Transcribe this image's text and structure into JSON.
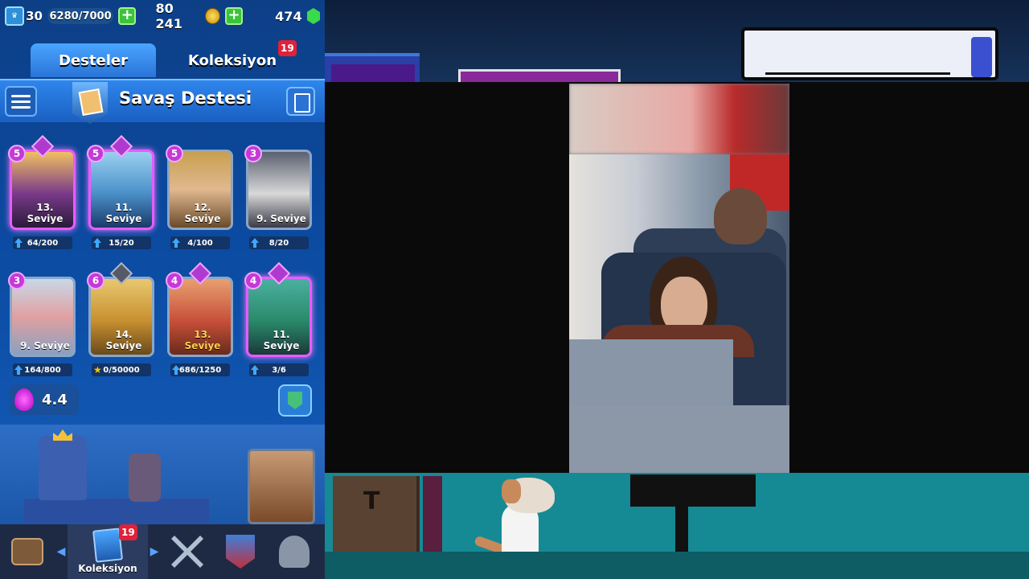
{
  "game": {
    "topbar": {
      "king_level": "30",
      "xp": "6280/7000",
      "gold": "80 241",
      "gems": "474"
    },
    "tabs": {
      "decks_label": "Desteler",
      "collection_label": "Koleksiyon",
      "collection_badge": "19"
    },
    "deck": {
      "title": "Savaş Destesi"
    },
    "cards": [
      {
        "elixir": "5",
        "level": "13. Seviye",
        "progress": "64/200",
        "rarity": "legendary"
      },
      {
        "elixir": "5",
        "level": "11. Seviye",
        "progress": "15/20",
        "rarity": "legendary"
      },
      {
        "elixir": "5",
        "level": "12. Seviye",
        "progress": "4/100",
        "rarity": "rare"
      },
      {
        "elixir": "3",
        "level": "9. Seviye",
        "progress": "8/20",
        "rarity": "epic"
      },
      {
        "elixir": "3",
        "level": "9. Seviye",
        "progress": "164/800",
        "rarity": "rare"
      },
      {
        "elixir": "6",
        "level": "14. Seviye",
        "progress": "0/50000",
        "rarity": "champion"
      },
      {
        "elixir": "4",
        "level": "13. Seviye",
        "progress": "686/1250",
        "rarity": "epic"
      },
      {
        "elixir": "4",
        "level": "11. Seviye",
        "progress": "3/6",
        "rarity": "legendary"
      }
    ],
    "average_elixir": "4.4",
    "bottom_nav": {
      "collection_label": "Koleksiyon",
      "collection_badge": "19"
    }
  },
  "overlay": {
    "speech_bubble_text": ""
  },
  "colors": {
    "game_bg": "#0b4aa0",
    "accent_blue": "#2f86ec",
    "badge_red": "#e0213a",
    "elixir_purple": "#c43ad6",
    "teal_floor": "#158a94"
  },
  "icons": [
    "shield-level-icon",
    "plus-icon",
    "gold-coin-icon",
    "gem-icon",
    "menu-icon",
    "deck-icon",
    "copy-deck-icon",
    "elixir-drop-icon",
    "tower-icon",
    "shop-chest-icon",
    "battle-swords-icon",
    "clan-shield-icon",
    "events-icon"
  ]
}
